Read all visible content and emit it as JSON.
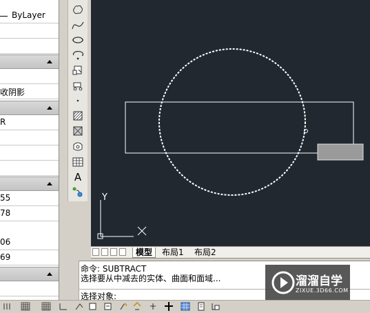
{
  "properties_panel": {
    "linetype_value": "ByLayer",
    "shadow_value": "收阴影",
    "material_value": "R",
    "geom_values": [
      "55",
      "78",
      "06",
      "69"
    ]
  },
  "draw_toolbar": {
    "tools": [
      "revcloud-icon",
      "spline-icon",
      "ellipse-icon",
      "ellipse-arc-icon",
      "insert-block-icon",
      "make-block-icon",
      "point-icon",
      "hatch-icon",
      "gradient-icon",
      "region-icon",
      "table-icon",
      "multiline-text-icon",
      "add-selected-icon"
    ],
    "text_tool_glyph": "A"
  },
  "ucs": {
    "y_label": "Y"
  },
  "layout_tabs": [
    "模型",
    "布局1",
    "布局2"
  ],
  "command_line": {
    "lines": [
      "命令: SUBTRACT",
      "选择要从中减去的实体、曲面和面域..."
    ],
    "prompt": "选择对象:"
  },
  "watermark": {
    "title": "溜溜自学",
    "url": "ZIXUE.3D66.COM"
  },
  "colors": {
    "canvas_bg": "#212830",
    "entity": "#ffffff",
    "grip_box": "#9a9a9a",
    "palette_header": "#c8c8c8"
  }
}
